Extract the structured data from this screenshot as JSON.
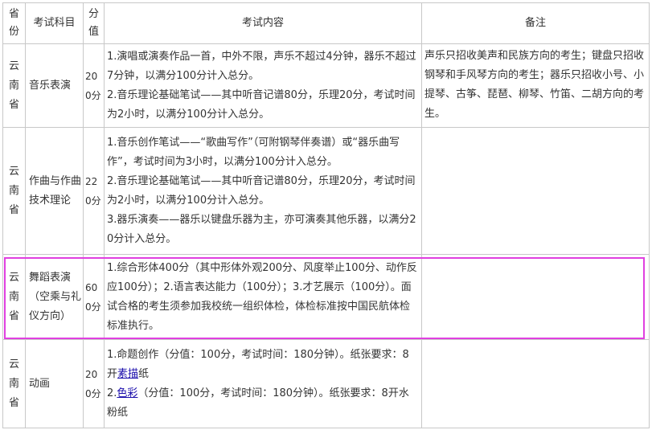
{
  "headers": {
    "province": "省份",
    "subject": "考试科目",
    "score": "分值",
    "content": "考试内容",
    "notes": "备注"
  },
  "rows": [
    {
      "province": "云南省",
      "subject": "音乐表演",
      "score": "200分",
      "content": [
        "1.演唱或演奏作品一首，中外不限，声乐不超过4分钟，器乐不超过7分钟，以满分100分计入总分。",
        "2.音乐理论基础笔试——其中听音记谱80分，乐理20分，考试时间为2小时，以满分100分计入总分。"
      ],
      "notes": "声乐只招收美声和民族方向的考生；键盘只招收钢琴和手风琴方向的考生；器乐只招收小号、小提琴、古筝、琵琶、柳琴、竹笛、二胡方向的考生。"
    },
    {
      "province": "云南省",
      "subject": "作曲与作曲技术理论",
      "score": "220分",
      "content": [
        "1.音乐创作笔试——“歌曲写作”（可附钢琴伴奏谱）或“器乐曲写作”，考试时间为3小时，以满分100分计入总分。",
        "2.音乐理论基础笔试——其中听音记谱80分，乐理20分，考试时间为2小时，以满分100分计入总分。",
        "3.器乐演奏——器乐以键盘乐器为主，亦可演奏其他乐器，以满分20分计入总分。"
      ],
      "notes": ""
    },
    {
      "province": "云南省",
      "subject": "舞蹈表演（空乘与礼仪方向）",
      "score": "600分",
      "content": [
        "1.综合形体400分（其中形体外观200分、风度举止100分、动作反应100分）；2.语言表达能力（100分）；3.才艺展示（100分）。面试合格的考生须参加我校统一组织体检，体检标准按中国民航体检标准执行。"
      ],
      "notes": ""
    },
    {
      "province": "云南省",
      "subject": "动画",
      "score": "200分",
      "content_parts": {
        "l1_a": "1.命题创作（分值：100分，考试时间：180分钟）。纸张要求：8开",
        "l1_link": "素描",
        "l1_b": "纸",
        "l2_a": "2.",
        "l2_link": "色彩",
        "l2_b": "（分值：100分，考试时间：180分钟）。纸张要求：8开水粉纸"
      },
      "notes": ""
    }
  ],
  "highlight_color": "#e040e0",
  "link_color": "#1a0dab"
}
